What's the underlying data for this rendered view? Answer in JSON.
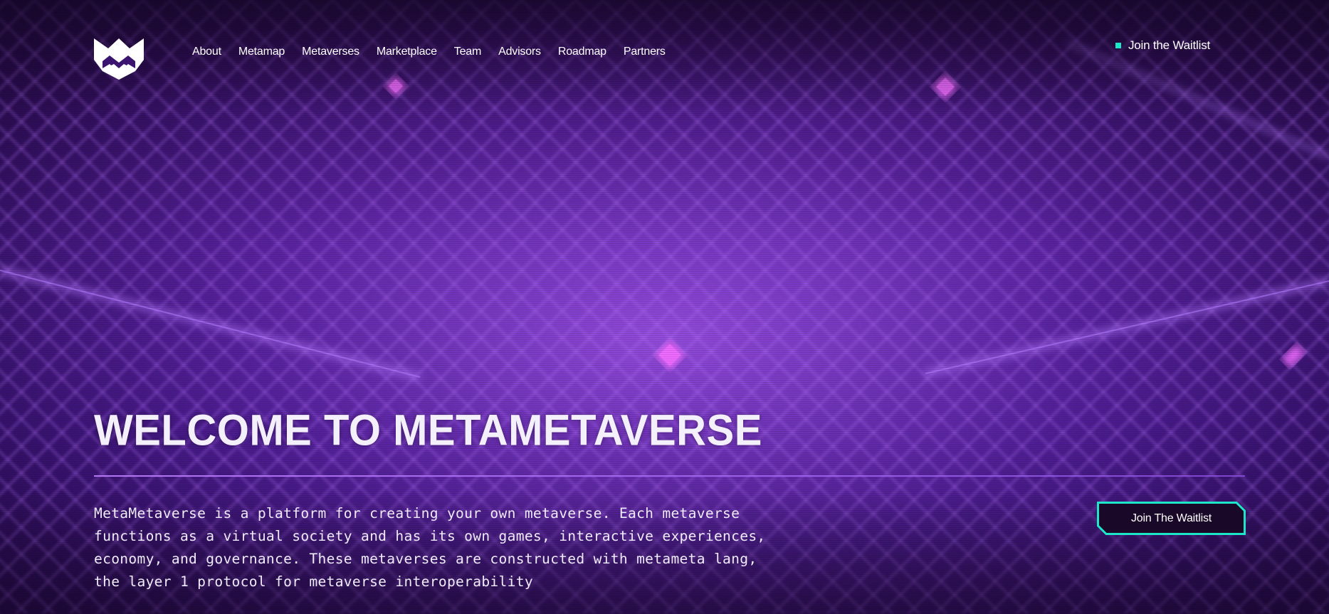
{
  "brand": {
    "logo_icon": "metametaverse-m-logo-icon",
    "accent_color": "#1ee6c8",
    "background_color": "#4a1a8a"
  },
  "nav": {
    "items": [
      {
        "label": "About"
      },
      {
        "label": "Metamap"
      },
      {
        "label": "Metaverses"
      },
      {
        "label": "Marketplace"
      },
      {
        "label": "Team"
      },
      {
        "label": "Advisors"
      },
      {
        "label": "Roadmap"
      },
      {
        "label": "Partners"
      }
    ],
    "waitlist_label": "Join the Waitlist"
  },
  "hero": {
    "title": "WELCOME TO METAMETAVERSE",
    "description": "MetaMetaverse is a platform for creating your own metaverse. Each metaverse functions as a virtual society and has its own games, interactive experiences, economy, and governance. These metaverses are constructed with metameta lang, the layer 1 protocol for metaverse interoperability",
    "cta_label": "Join The Waitlist"
  }
}
